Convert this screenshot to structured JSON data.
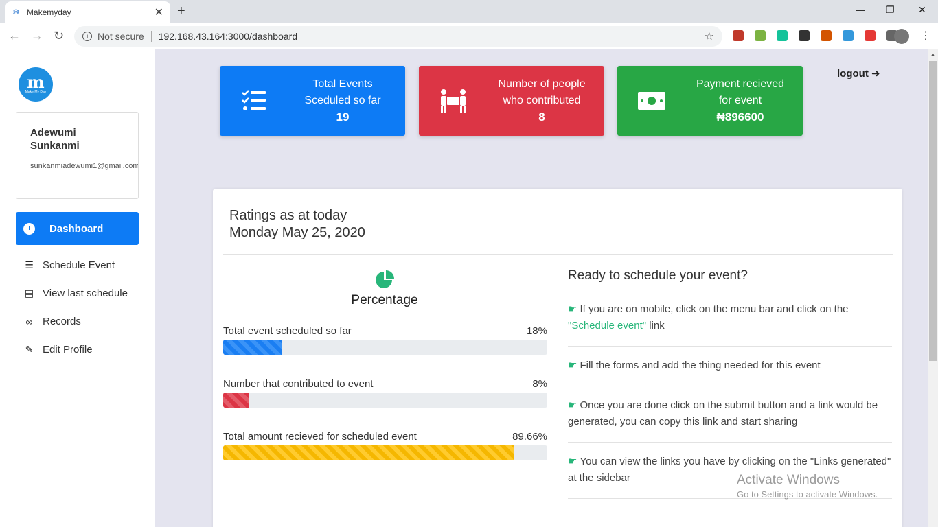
{
  "browser": {
    "tab_title": "Makemyday",
    "tab_close": "✕",
    "new_tab": "+",
    "back": "←",
    "forward": "→",
    "reload": "↻",
    "security_label": "Not secure",
    "url": "192.168.43.164:3000/dashboard",
    "minimize": "—",
    "maximize": "❐",
    "close": "✕",
    "extension_colors": [
      "#c0392b",
      "#7cb342",
      "#15c39a",
      "#333333",
      "#d35400",
      "#3498db",
      "#e53935",
      "#666666"
    ]
  },
  "sidebar": {
    "logo_text": "m",
    "logo_subtext": "Make My Day",
    "user_name": "Adewumi Sunkanmi",
    "user_email": "sunkanmiadewumi1@gmail.com",
    "active_item": "Dashboard",
    "items": [
      {
        "label": "Schedule Event",
        "icon": "list-check-icon"
      },
      {
        "label": "View last schedule",
        "icon": "table-list-icon"
      },
      {
        "label": "Records",
        "icon": "link-icon"
      },
      {
        "label": "Edit Profile",
        "icon": "pencil-icon"
      }
    ]
  },
  "stats": [
    {
      "label_line1": "Total Events",
      "label_line2": "Sceduled so far",
      "value": "19",
      "color": "#0d7bf5",
      "icon": "tasks-icon"
    },
    {
      "label_line1": "Number of people",
      "label_line2": "who contributed",
      "value": "8",
      "color": "#dc3545",
      "icon": "people-carry-icon"
    },
    {
      "label_line1": "Payment recieved",
      "label_line2": "for event",
      "value": "₦896600",
      "color": "#28a745",
      "icon": "money-bill-icon"
    }
  ],
  "logout_label": "logout",
  "panel": {
    "title_line1": "Ratings as at today",
    "title_line2": "Monday May 25, 2020",
    "percentage_title": "Percentage",
    "progress": [
      {
        "label": "Total event scheduled so far",
        "percent_text": "18%",
        "fraction": 0.18,
        "style": "blue"
      },
      {
        "label": "Number that contributed to event",
        "percent_text": "8%",
        "fraction": 0.08,
        "style": "red"
      },
      {
        "label": "Total amount recieved for scheduled event",
        "percent_text": "89.66%",
        "fraction": 0.8966,
        "style": "yellow"
      }
    ],
    "ready_title": "Ready to schedule your event?",
    "tips": [
      {
        "text": "If you are on mobile, click on the menu bar and click on the ",
        "link": "\"Schedule event\"",
        "after": " link"
      },
      {
        "text": "Fill the forms and add the thing needed for this event"
      },
      {
        "text": "Once you are done click on the submit button and a link would be generated, you can copy this link and start sharing"
      },
      {
        "text": "You can view the links you have by clicking on the \"Links generated\" at the sidebar"
      }
    ]
  },
  "watermark": {
    "line1": "Activate Windows",
    "line2": "Go to Settings to activate Windows."
  }
}
